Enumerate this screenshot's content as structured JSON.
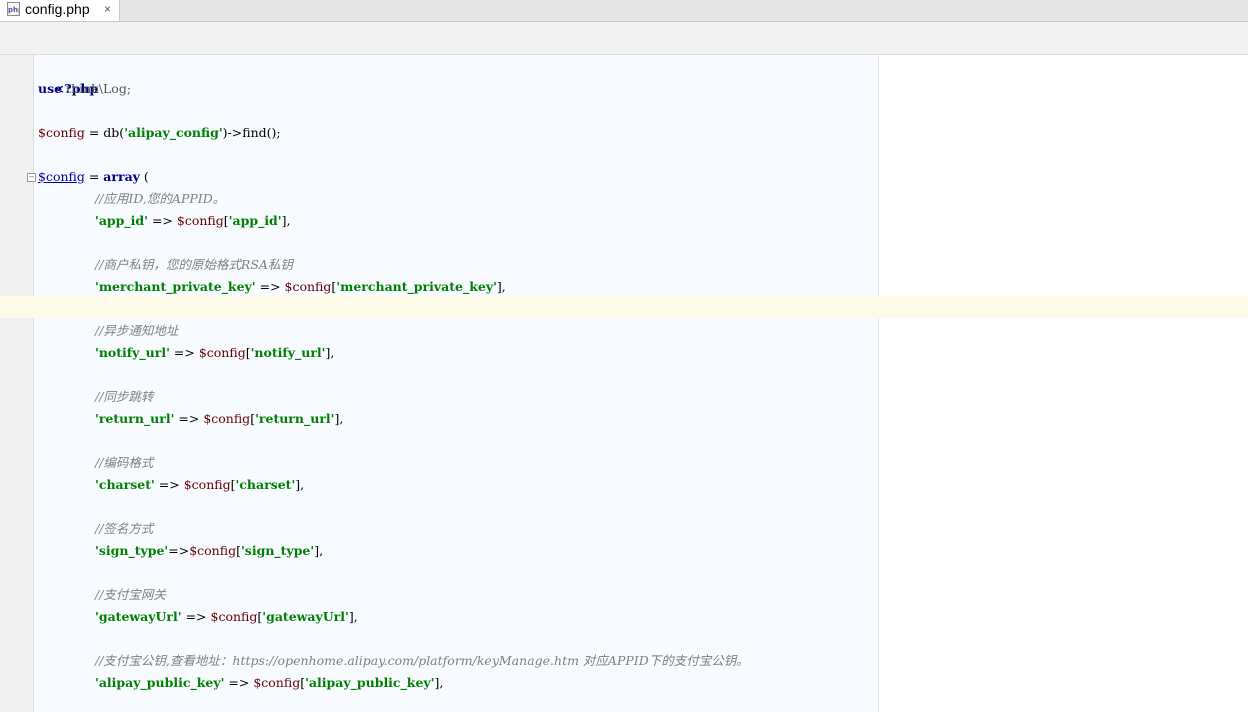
{
  "tab": {
    "icon_text": "php",
    "title": "config.php",
    "close": "×"
  },
  "code": {
    "l1_tag": "<?php",
    "l2_kw": "use",
    "l2_ns": "think\\Log;",
    "l4_var": "$config",
    "l4_a": " = db(",
    "l4_str": "'alipay_config'",
    "l4_b": ")->find();",
    "l6_var": "$config",
    "l6_a": " = ",
    "l6_kw": "array",
    "l6_b": " (",
    "entries": [
      {
        "comment": "//应用ID,您的APPID。",
        "key": "'app_id'",
        "sep": " => ",
        "var": "$config",
        "open": "[",
        "idx": "'app_id'",
        "close": "],"
      },
      {
        "comment": "//商户私钥，您的原始格式RSA私钥",
        "key": "'merchant_private_key'",
        "sep": " => ",
        "var": "$config",
        "open": "[",
        "idx": "'merchant_private_key'",
        "close": "],"
      },
      {
        "comment": "//异步通知地址",
        "key": "'notify_url'",
        "sep": " => ",
        "var": "$config",
        "open": "[",
        "idx": "'notify_url'",
        "close": "],"
      },
      {
        "comment": "//同步跳转",
        "key": "'return_url'",
        "sep": " => ",
        "var": "$config",
        "open": "[",
        "idx": "'return_url'",
        "close": "],"
      },
      {
        "comment": "//编码格式",
        "key": "'charset'",
        "sep": " => ",
        "var": "$config",
        "open": "[",
        "idx": "'charset'",
        "close": "],"
      },
      {
        "comment": "//签名方式",
        "key": "'sign_type'",
        "sep": "=>",
        "var": "$config",
        "open": "[",
        "idx": "'sign_type'",
        "close": "],"
      },
      {
        "comment": "//支付宝网关",
        "key": "'gatewayUrl'",
        "sep": " => ",
        "var": "$config",
        "open": "[",
        "idx": "'gatewayUrl'",
        "close": "],"
      },
      {
        "comment": "//支付宝公钥,查看地址：https://openhome.alipay.com/platform/keyManage.htm 对应APPID下的支付宝公钥。",
        "key": "'alipay_public_key'",
        "sep": " => ",
        "var": "$config",
        "open": "[",
        "idx": "'alipay_public_key'",
        "close": "],"
      }
    ]
  },
  "colors": {
    "keyword": "#000080",
    "string": "#008000",
    "variable": "#660000",
    "comment": "#808080",
    "caret_line": "#fdfbe8"
  }
}
